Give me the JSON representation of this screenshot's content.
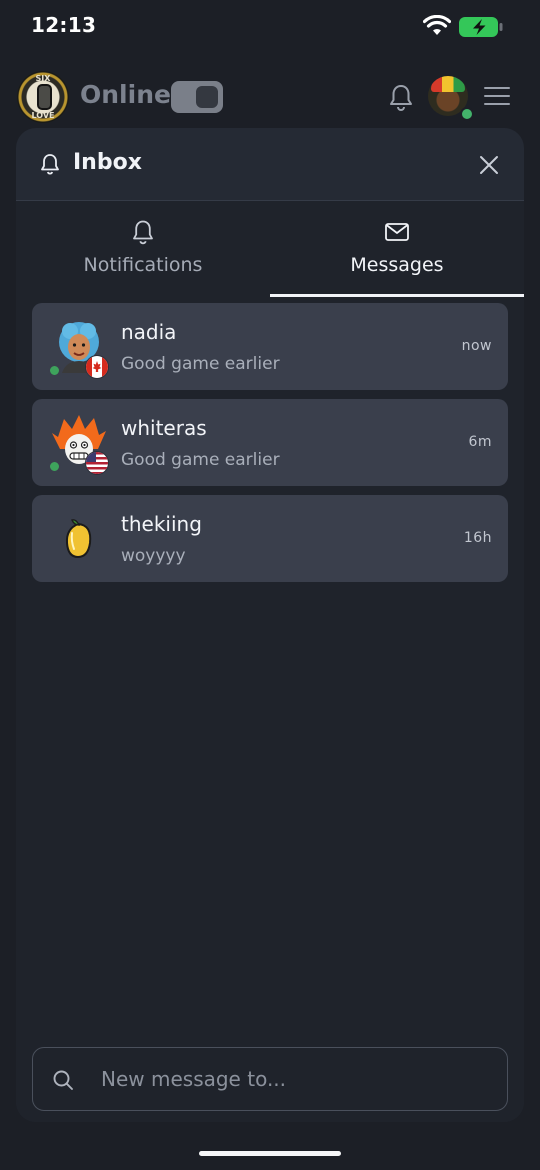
{
  "status_bar": {
    "time": "12:13"
  },
  "header": {
    "logo_text_top": "SIX",
    "logo_text_bottom": "LOVE",
    "status_label": "Online",
    "toggle_on": true
  },
  "panel": {
    "title": "Inbox",
    "tabs": [
      {
        "label": "Notifications",
        "icon": "bell-icon",
        "active": false
      },
      {
        "label": "Messages",
        "icon": "envelope-icon",
        "active": true
      }
    ],
    "messages": [
      {
        "name": "nadia",
        "preview": "Good game earlier",
        "time": "now",
        "online": true,
        "flag": "canada-flag-icon"
      },
      {
        "name": "whiteras",
        "preview": "Good game earlier",
        "time": "6m",
        "online": true,
        "flag": "usa-flag-icon"
      },
      {
        "name": "thekiing",
        "preview": "woyyyy",
        "time": "16h",
        "online": false,
        "flag": ""
      }
    ],
    "compose": {
      "placeholder": "New message to..."
    }
  },
  "colors": {
    "background": "#1c1f26",
    "panel": "#252a34",
    "row": "#3a3f4c",
    "online": "#3ea35c",
    "battery": "#34c759"
  }
}
